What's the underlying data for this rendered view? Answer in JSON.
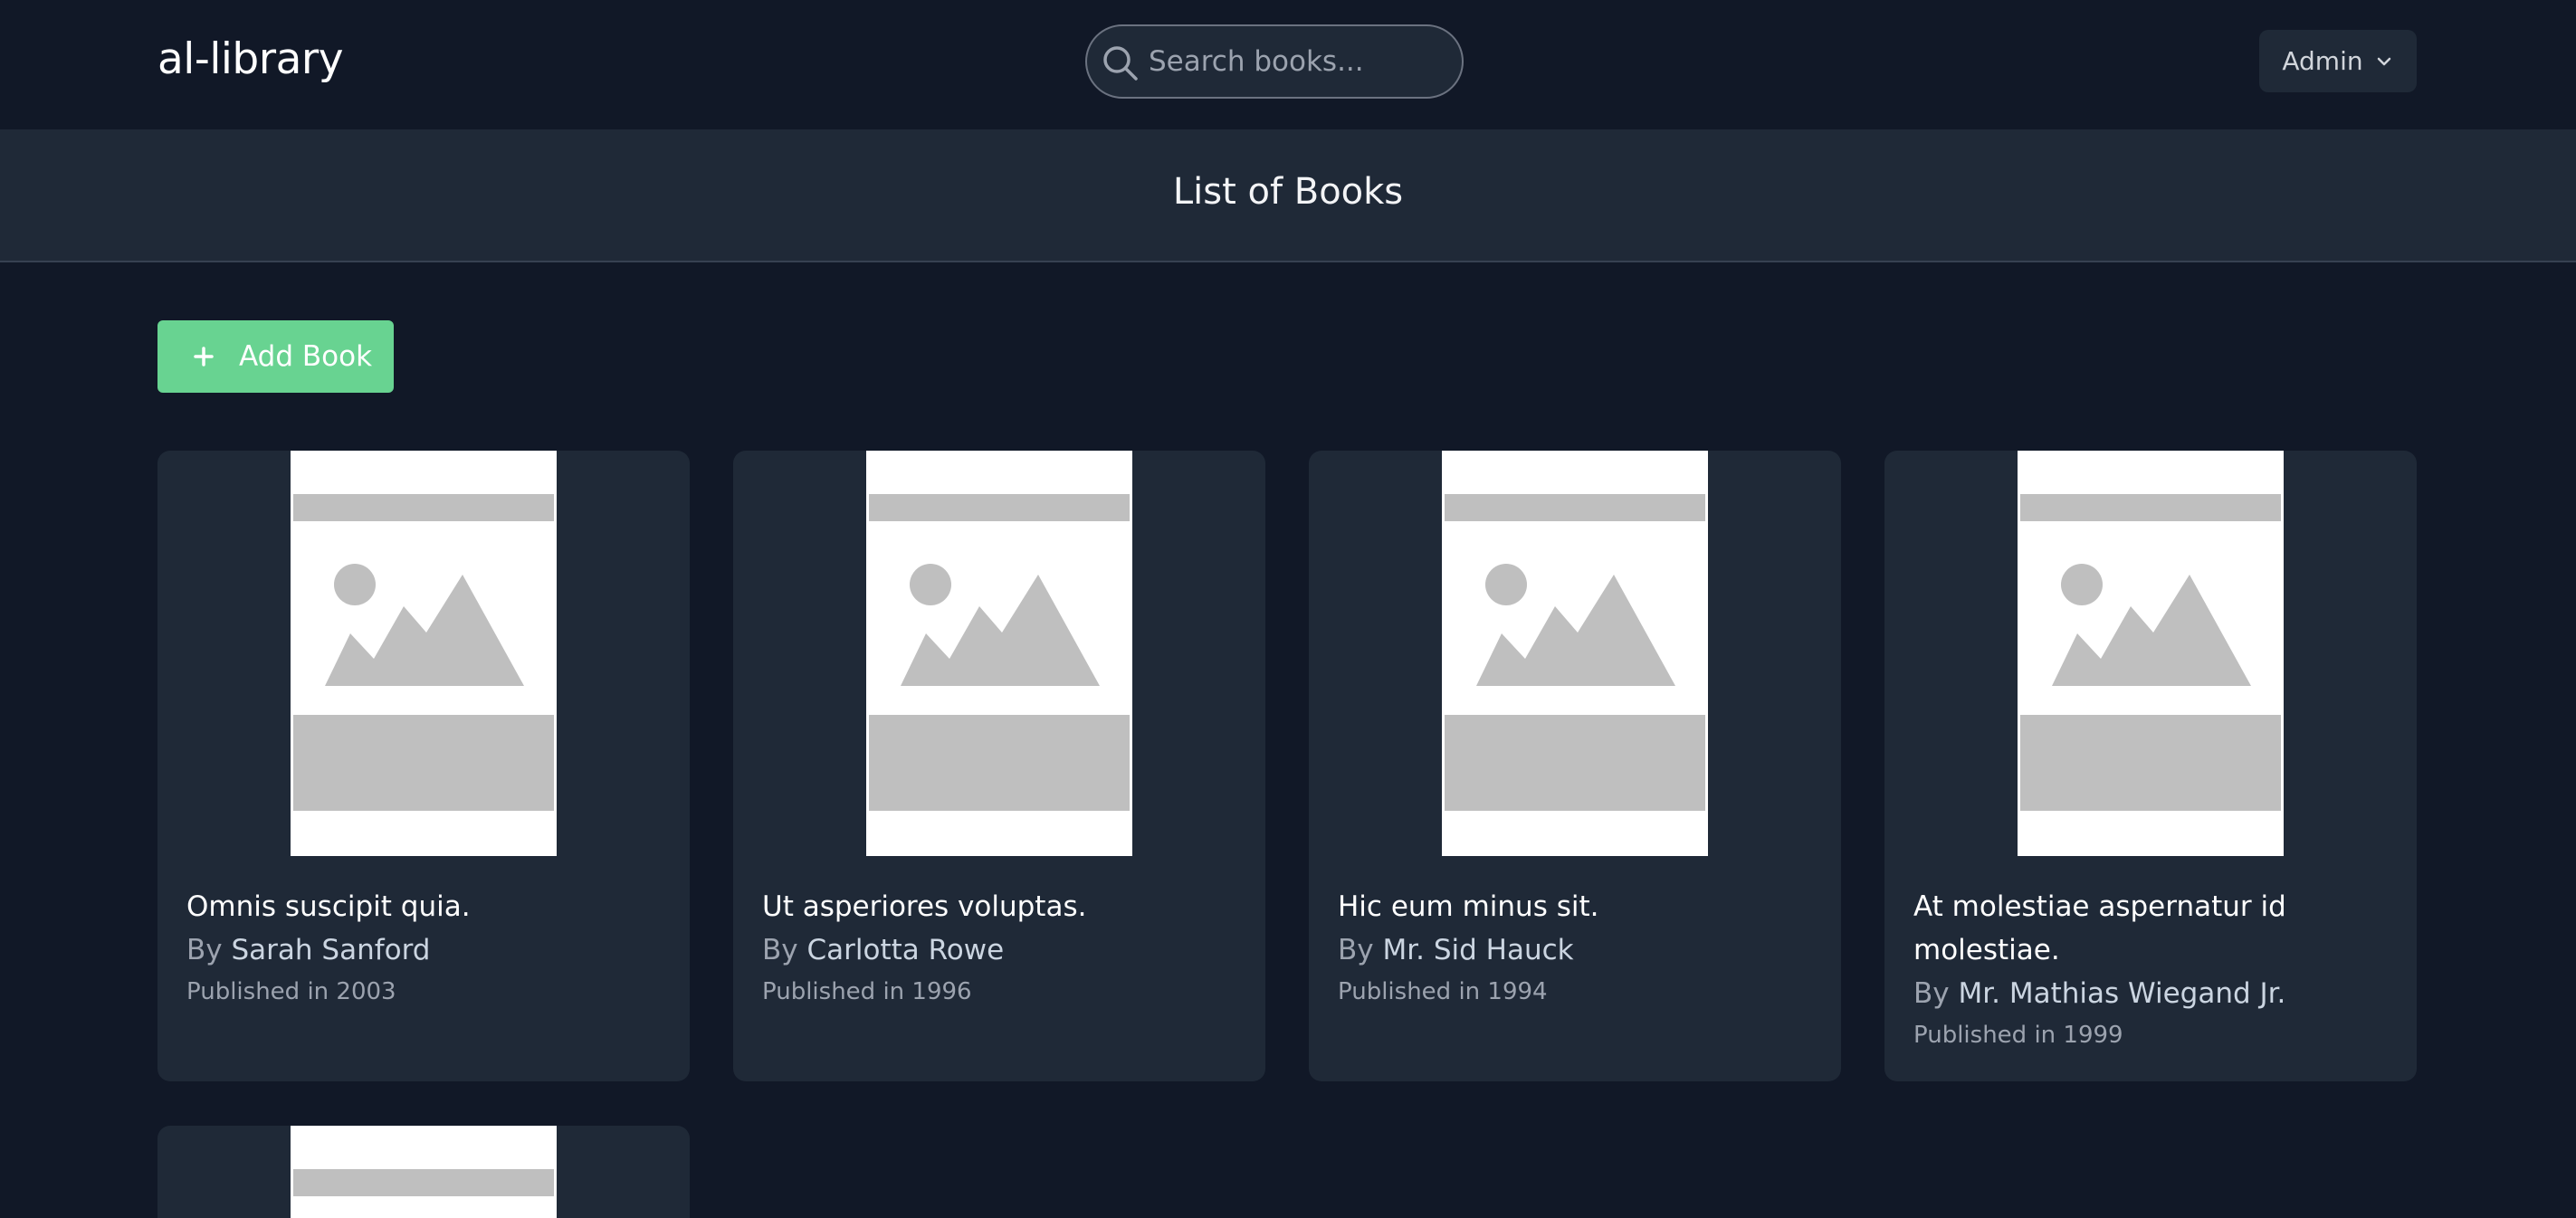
{
  "app": {
    "name": "al-library"
  },
  "search": {
    "placeholder": "Search books..."
  },
  "user_menu": {
    "label": "Admin"
  },
  "page": {
    "title": "List of Books"
  },
  "actions": {
    "add_book_label": "Add Book"
  },
  "books": [
    {
      "title": "Omnis suscipit quia.",
      "by_label": "By",
      "author": "Sarah Sanford",
      "published": "Published in 2003"
    },
    {
      "title": "Ut asperiores voluptas.",
      "by_label": "By",
      "author": "Carlotta Rowe",
      "published": "Published in 1996"
    },
    {
      "title": "Hic eum minus sit.",
      "by_label": "By",
      "author": "Mr. Sid Hauck",
      "published": "Published in 1994"
    },
    {
      "title": "At molestiae aspernatur id molestiae.",
      "by_label": "By",
      "author": "Mr. Mathias Wiegand Jr.",
      "published": "Published in 1999"
    }
  ],
  "colors": {
    "background": "#111827",
    "surface": "#1f2937",
    "accent": "#68d391",
    "muted_text": "#9ca3af"
  },
  "icons": {
    "search": "search-icon",
    "dropdown": "chevron-down-icon",
    "add": "plus-icon",
    "cover_placeholder": "image-placeholder-icon"
  }
}
